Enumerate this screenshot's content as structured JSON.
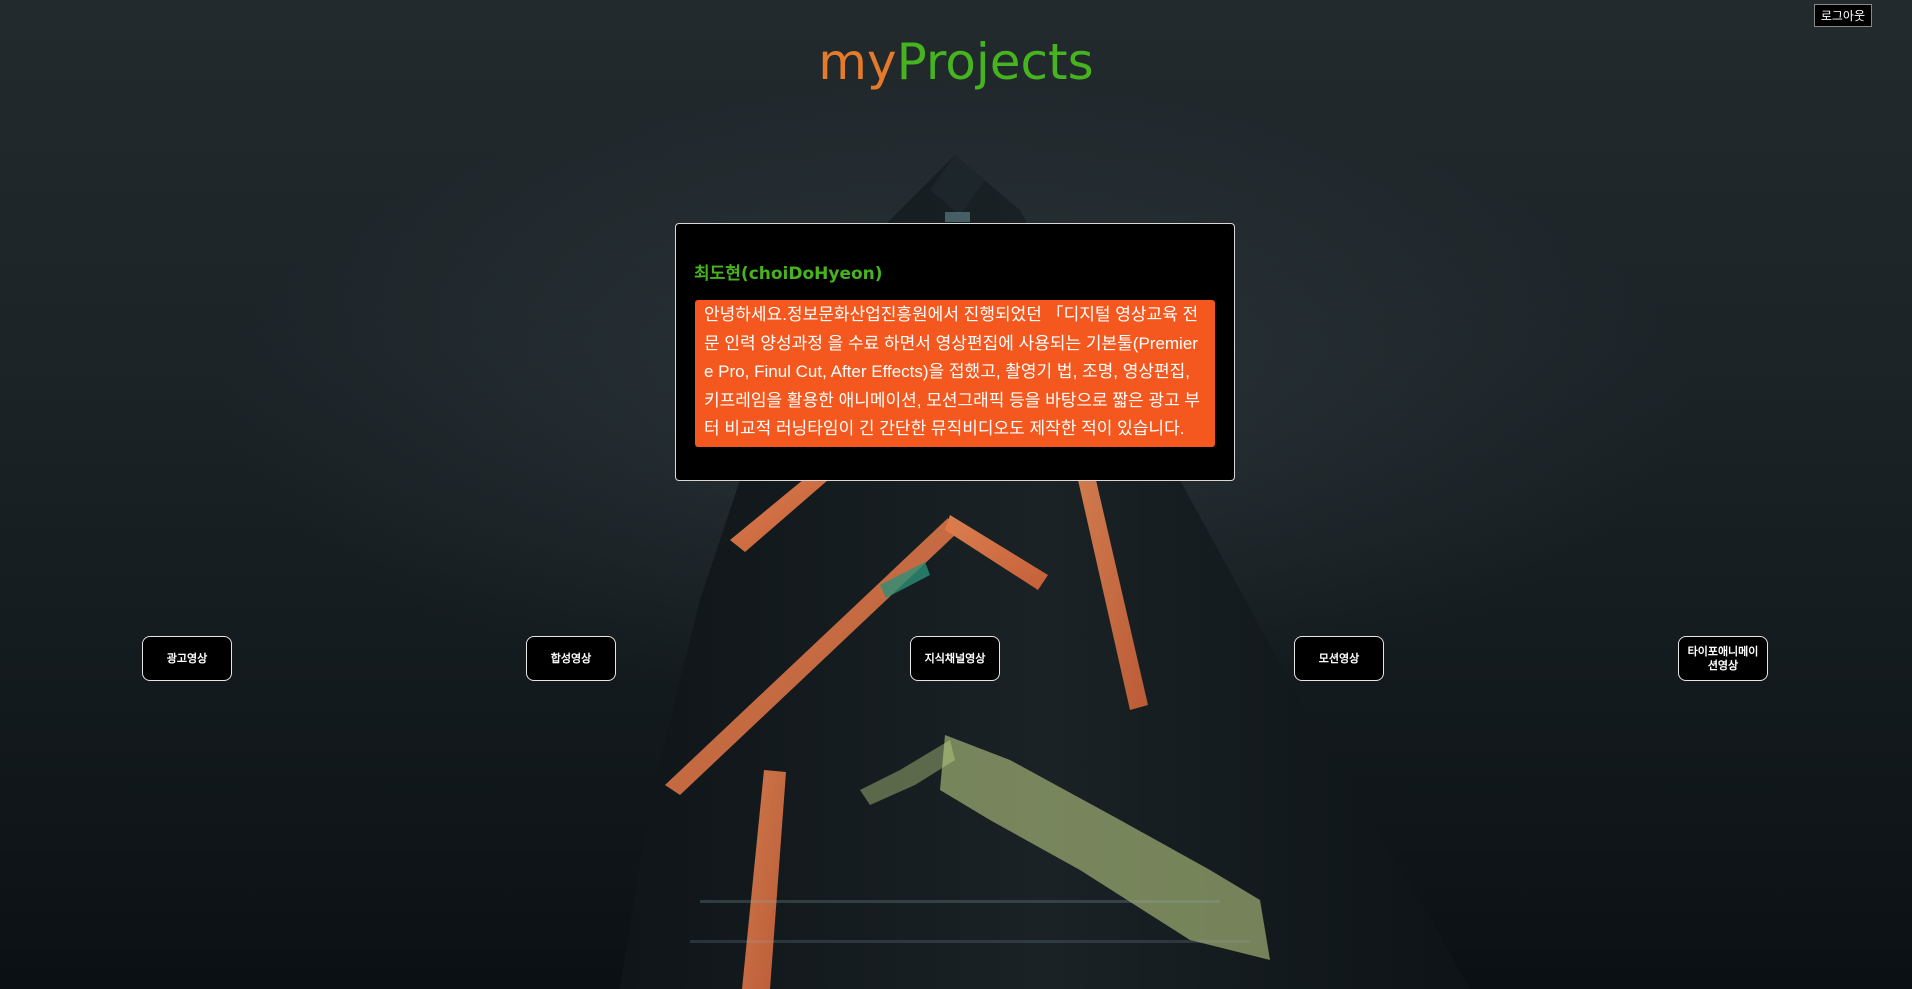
{
  "header": {
    "logout_label": "로그아웃",
    "title_part1": "my",
    "title_part2": "Projects"
  },
  "profile": {
    "name": "최도현(choiDoHyeon)",
    "bio": "안녕하세요.정보문화산업진흥원에서 진행되었던 「디지털 영상교육 전문 인력 양성과정 을 수료 하면서 영상편집에 사용되는 기본툴(Premiere Pro, Finul Cut, After Effects)을 접했고, 촬영기 법, 조명, 영상편집, 키프레임을 활용한 애니메이션, 모션그래픽 등을 바탕으로 짧은 광고 부터 비교적 러닝타임이 긴 간단한 뮤직비디오도 제작한 적이 있습니다."
  },
  "categories": [
    {
      "label": "광고영상"
    },
    {
      "label": "합성영상"
    },
    {
      "label": "지식채널영상"
    },
    {
      "label": "모션영상"
    },
    {
      "label": "타이포애니메이션영상"
    }
  ],
  "colors": {
    "title_my": "#e47a2a",
    "title_projects": "#46b41e",
    "profile_name": "#46b41e",
    "bio_background": "#f4581e",
    "card_background": "#000000"
  }
}
